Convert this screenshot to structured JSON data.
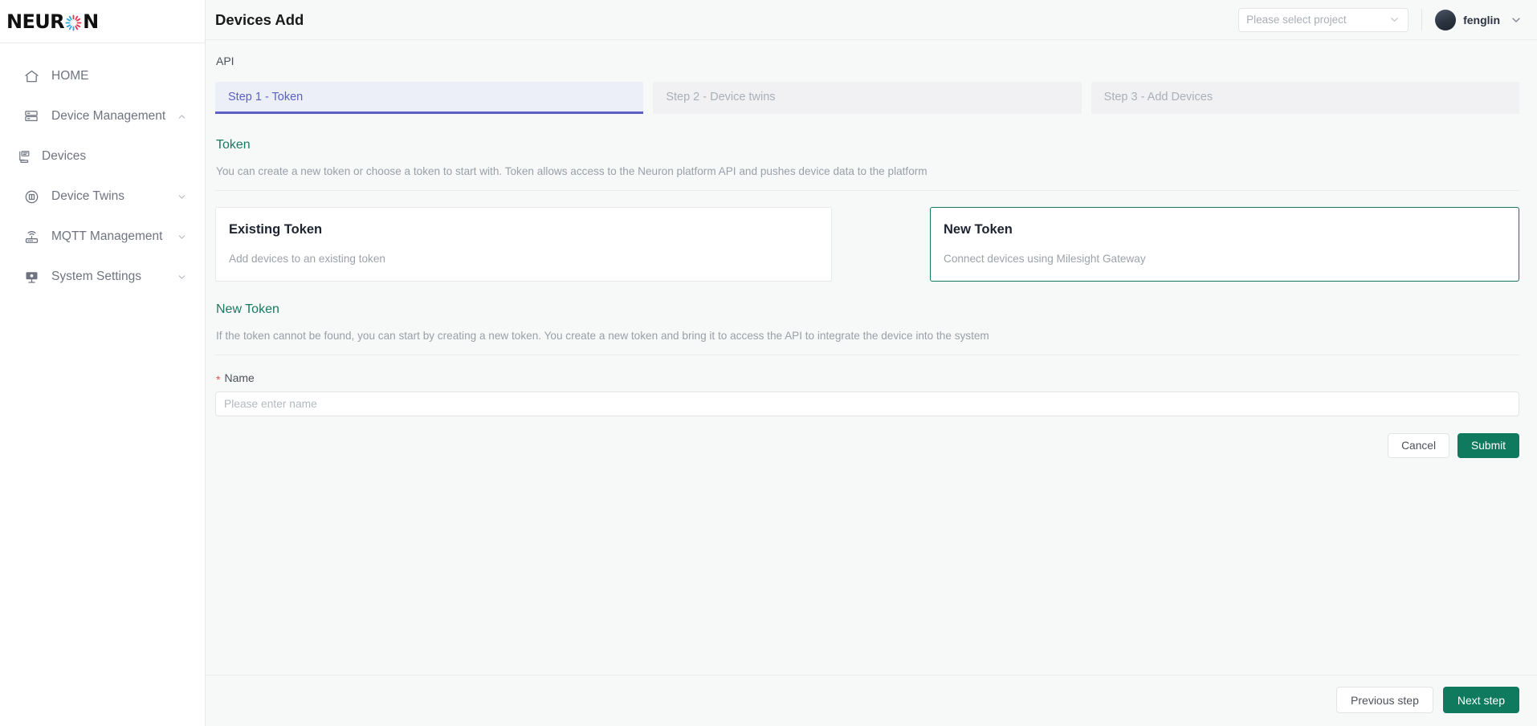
{
  "sidebar": {
    "logo_text_before": "NEUR",
    "logo_text_after": "N",
    "logo_mark_icon": "neuron-burst-icon",
    "items": [
      {
        "label": "HOME",
        "icon": "home-icon",
        "expandable": false,
        "sub": false
      },
      {
        "label": "Device Management",
        "icon": "server-rack-icon",
        "expandable": true,
        "expanded": true,
        "sub": false
      },
      {
        "label": "Devices",
        "icon": "device-list-icon",
        "expandable": false,
        "sub": true
      },
      {
        "label": "Device Twins",
        "icon": "device-twins-icon",
        "expandable": true,
        "expanded": false,
        "sub": false
      },
      {
        "label": "MQTT Management",
        "icon": "router-wifi-icon",
        "expandable": true,
        "expanded": false,
        "sub": false
      },
      {
        "label": "System Settings",
        "icon": "monitor-settings-icon",
        "expandable": true,
        "expanded": false,
        "sub": false
      }
    ]
  },
  "header": {
    "title": "Devices Add",
    "project_select": {
      "placeholder": "Please select project",
      "value": "",
      "chevron_icon": "chevron-down-icon"
    },
    "user": {
      "name": "fenglin",
      "avatar_icon": "avatar-icon",
      "chevron_icon": "chevron-down-icon"
    }
  },
  "main": {
    "api_label": "API",
    "steps": [
      {
        "label": "Step 1 - Token",
        "active": true
      },
      {
        "label": "Step 2 - Device twins",
        "active": false
      },
      {
        "label": "Step 3 - Add Devices",
        "active": false
      }
    ],
    "token_section": {
      "title": "Token",
      "description": "You can create a new token or choose a token to start with. Token allows access to the Neuron platform API and pushes device data to the platform",
      "cards": [
        {
          "title": "Existing Token",
          "subtitle": "Add devices to an existing token",
          "selected": false
        },
        {
          "title": "New Token",
          "subtitle": "Connect devices using Milesight Gateway",
          "selected": true
        }
      ]
    },
    "new_token_section": {
      "title": "New Token",
      "description": "If the token cannot be found, you can start by creating a new token. You create a new token and bring it to access the API to integrate the device into the system",
      "name_field": {
        "label": "Name",
        "required_marker": "*",
        "value": "",
        "placeholder": "Please enter name"
      },
      "cancel_label": "Cancel",
      "submit_label": "Submit"
    }
  },
  "footer": {
    "previous_label": "Previous step",
    "next_label": "Next step"
  },
  "colors": {
    "brand_teal": "#0f7a5e",
    "section_title_teal": "#1a7a5e",
    "active_step_indigo": "#5c60c4",
    "active_step_bg": "#eceef8",
    "required_red": "#e8534d",
    "content_bg": "#f7f8f8"
  }
}
